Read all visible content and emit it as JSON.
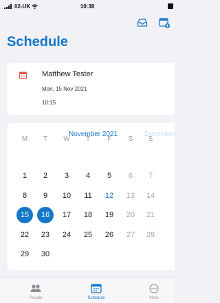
{
  "status_bar": {
    "carrier": "02-UK",
    "time": "10:38"
  },
  "header": {
    "title": "Schedule",
    "icons": [
      "inbox-icon",
      "calendar-add-icon"
    ]
  },
  "appointment": {
    "name": "Matthew Tester",
    "date": "Mon, 15 Nov 2021",
    "time": "10:15"
  },
  "calendar": {
    "month": "November 2021",
    "next_month": "December",
    "weekdays": [
      "M",
      "T",
      "W",
      "T",
      "F",
      "S",
      "S"
    ],
    "weeks": [
      [
        "1",
        "2",
        "3",
        "4",
        "5",
        "6",
        "7"
      ],
      [
        "8",
        "9",
        "10",
        "11",
        "12",
        "13",
        "14"
      ],
      [
        "15",
        "16",
        "17",
        "18",
        "19",
        "20",
        "21"
      ],
      [
        "22",
        "23",
        "24",
        "25",
        "26",
        "27",
        "28"
      ],
      [
        "29",
        "30"
      ]
    ],
    "today": "12",
    "selected": [
      "15",
      "16"
    ]
  },
  "tab_bar": {
    "tabs": [
      {
        "label": "People",
        "icon": "people-icon"
      },
      {
        "label": "Schedule",
        "icon": "calendar-icon",
        "active": true
      },
      {
        "label": "More",
        "icon": "more-icon"
      }
    ]
  },
  "colors": {
    "accent": "#1677c9",
    "appointment_icon": "#e05a4f"
  }
}
